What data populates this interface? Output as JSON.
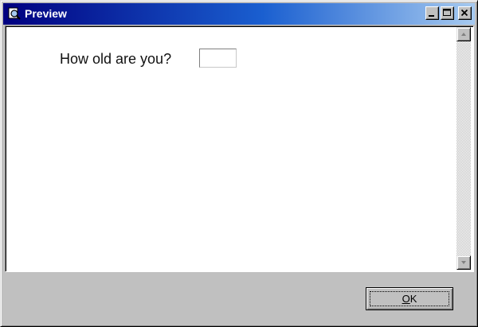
{
  "window": {
    "title": "Preview",
    "icon": "preview-magnifier-icon",
    "titlebar_colors": [
      "#000080",
      "#1a5fd0",
      "#a6caf0"
    ],
    "controls": {
      "minimize_icon": "minimize-icon",
      "maximize_icon": "maximize-icon",
      "close_icon": "close-icon"
    }
  },
  "form": {
    "question_label": "How old are you?",
    "age_value": "",
    "age_placeholder": ""
  },
  "scrollbar": {
    "up_icon": "arrow-up-icon",
    "down_icon": "arrow-down-icon"
  },
  "footer": {
    "ok_mnemonic": "O",
    "ok_rest": "K"
  }
}
